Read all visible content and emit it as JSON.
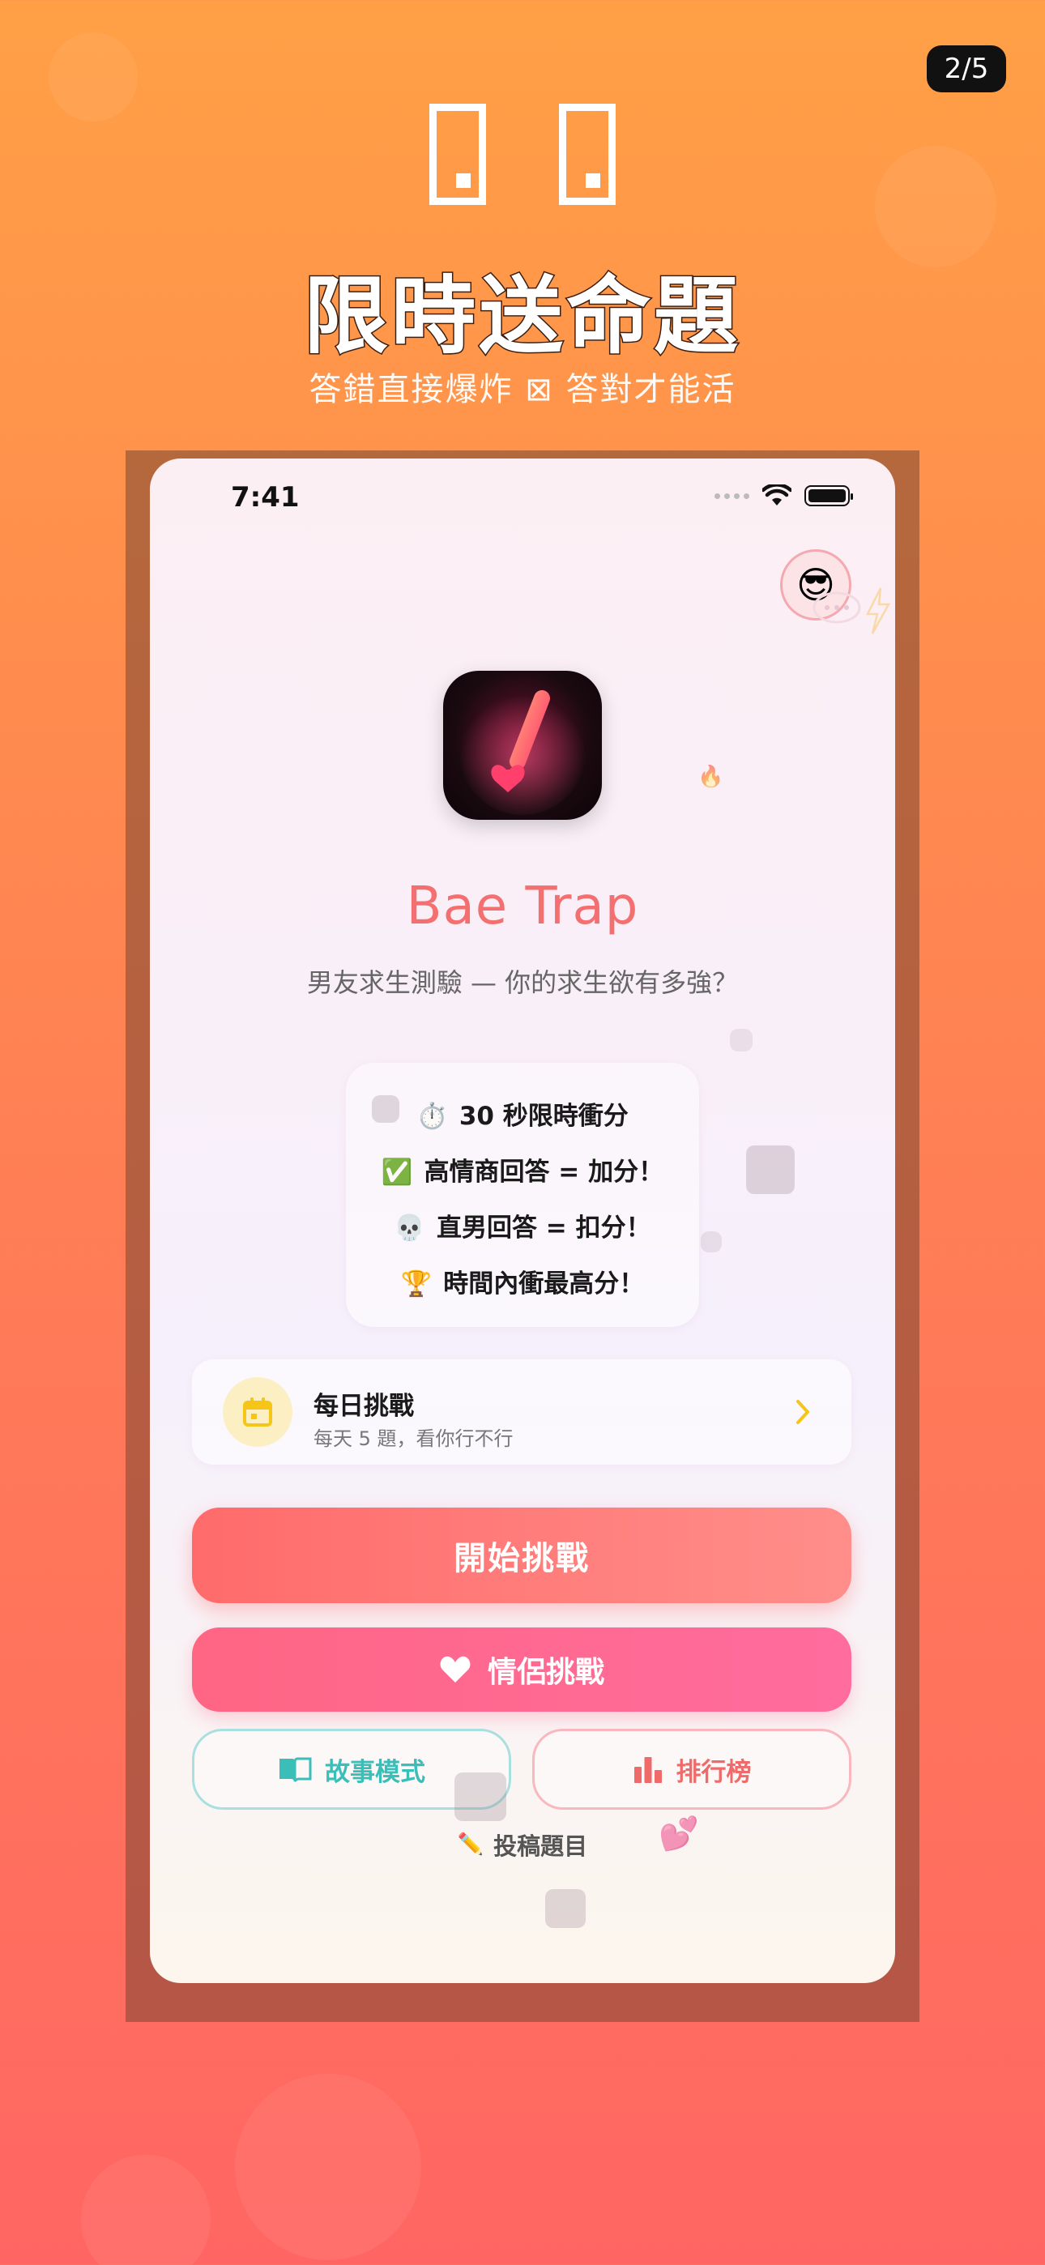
{
  "screen": {
    "page_indicator": "2/5",
    "hero_title": "限時送命題",
    "hero_subtitle": "答錯直接爆炸 ⊠ 答對才能活"
  },
  "status_bar": {
    "time": "7:41"
  },
  "app": {
    "name": "Bae Trap",
    "tagline": "男友求生測驗 — 你的求生欲有多強？"
  },
  "rules": [
    {
      "emoji": "⏱️",
      "text": "30 秒限時衝分"
    },
    {
      "emoji": "✅",
      "text": "高情商回答 = 加分！"
    },
    {
      "emoji": "💀",
      "text": "直男回答 = 扣分！"
    },
    {
      "emoji": "🏆",
      "text": "時間內衝最高分！"
    }
  ],
  "daily_challenge": {
    "title": "每日挑戰",
    "subtitle": "每天 5 題，看你行不行",
    "icon": "calendar-icon"
  },
  "buttons": {
    "start": "開始挑戰",
    "couple": "情侶挑戰",
    "story": "故事模式",
    "leaderboard": "排行榜",
    "submit": "投稿題目"
  },
  "decor": {
    "cool_emoji": "😎",
    "fire_emoji": "🔥",
    "hearts_emoji": "💕",
    "pencil_emoji": "✏️"
  },
  "colors": {
    "brand": "#F47070",
    "start_button": "#FF6B6B",
    "couple_button": "#FF6684",
    "story_accent": "#3BBDB8",
    "rank_accent": "#F06A6A",
    "daily_icon": "#F5C518"
  }
}
